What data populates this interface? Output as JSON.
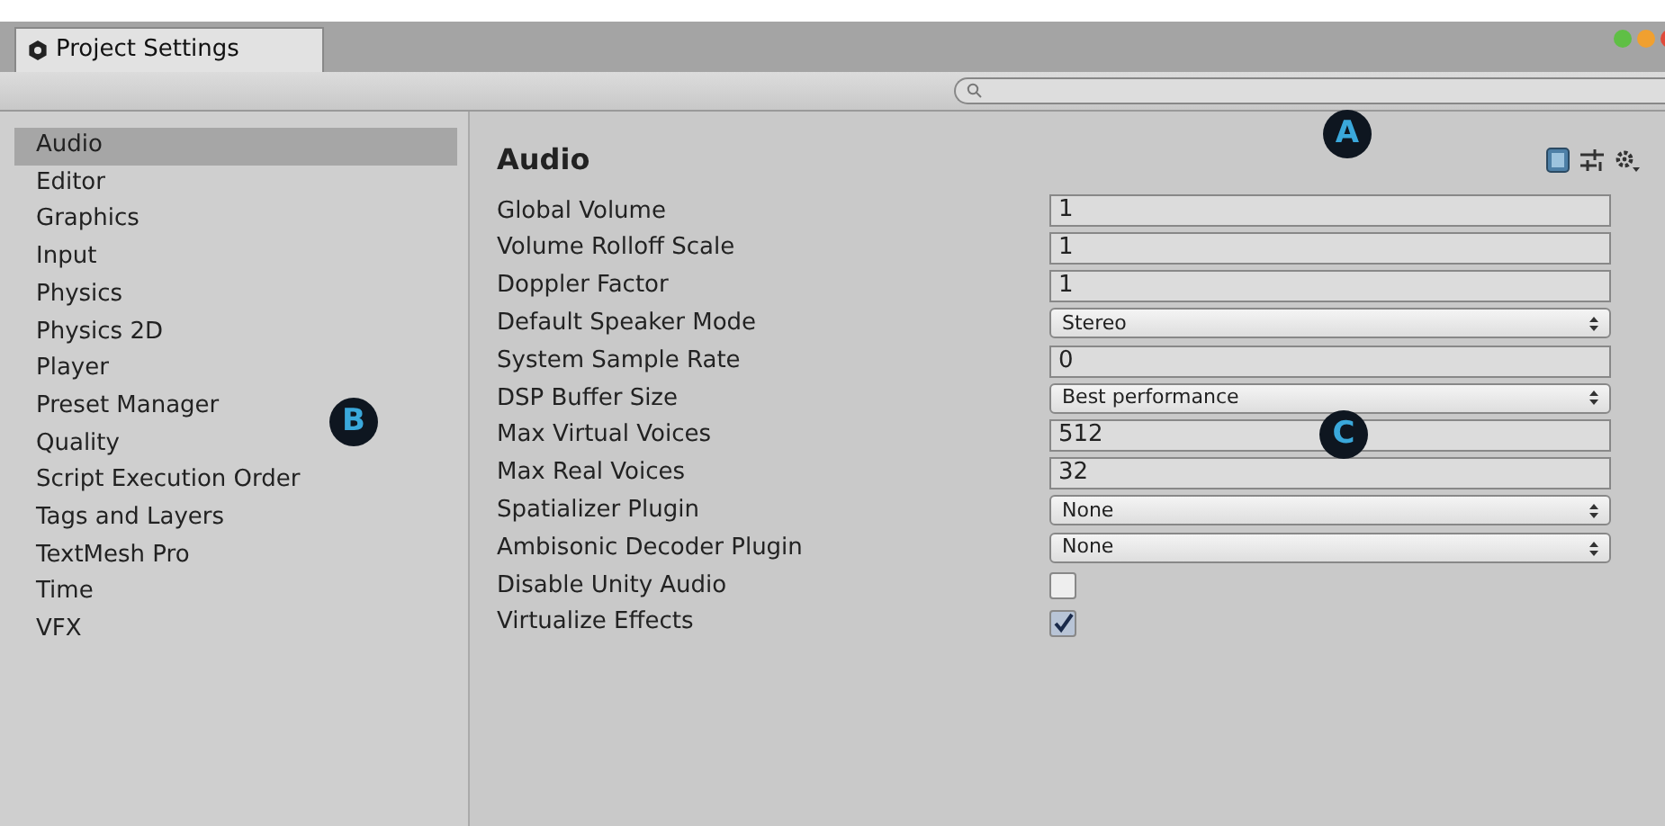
{
  "window": {
    "tab_title": "Project Settings"
  },
  "search": {
    "callout": "A"
  },
  "sidebar": {
    "callout": "B",
    "items": [
      {
        "label": "Audio",
        "selected": true
      },
      {
        "label": "Editor",
        "selected": false
      },
      {
        "label": "Graphics",
        "selected": false
      },
      {
        "label": "Input",
        "selected": false
      },
      {
        "label": "Physics",
        "selected": false
      },
      {
        "label": "Physics 2D",
        "selected": false
      },
      {
        "label": "Player",
        "selected": false
      },
      {
        "label": "Preset Manager",
        "selected": false
      },
      {
        "label": "Quality",
        "selected": false
      },
      {
        "label": "Script Execution Order",
        "selected": false
      },
      {
        "label": "Tags and Layers",
        "selected": false
      },
      {
        "label": "TextMesh Pro",
        "selected": false
      },
      {
        "label": "Time",
        "selected": false
      },
      {
        "label": "VFX",
        "selected": false
      }
    ]
  },
  "panel": {
    "title": "Audio",
    "callout": "C",
    "fields": [
      {
        "label": "Global Volume",
        "kind": "text",
        "value": "1"
      },
      {
        "label": "Volume Rolloff Scale",
        "kind": "text",
        "value": "1"
      },
      {
        "label": "Doppler Factor",
        "kind": "text",
        "value": "1"
      },
      {
        "label": "Default Speaker Mode",
        "kind": "dropdown",
        "value": "Stereo"
      },
      {
        "label": "System Sample Rate",
        "kind": "text",
        "value": "0"
      },
      {
        "label": "DSP Buffer Size",
        "kind": "dropdown",
        "value": "Best performance"
      },
      {
        "label": "Max Virtual Voices",
        "kind": "text",
        "value": "512"
      },
      {
        "label": "Max Real Voices",
        "kind": "text",
        "value": "32"
      },
      {
        "label": "Spatializer Plugin",
        "kind": "dropdown",
        "value": "None"
      },
      {
        "label": "Ambisonic Decoder Plugin",
        "kind": "dropdown",
        "value": "None"
      },
      {
        "label": "Disable Unity Audio",
        "kind": "checkbox",
        "checked": false
      },
      {
        "label": "Virtualize Effects",
        "kind": "checkbox",
        "checked": true
      }
    ]
  }
}
